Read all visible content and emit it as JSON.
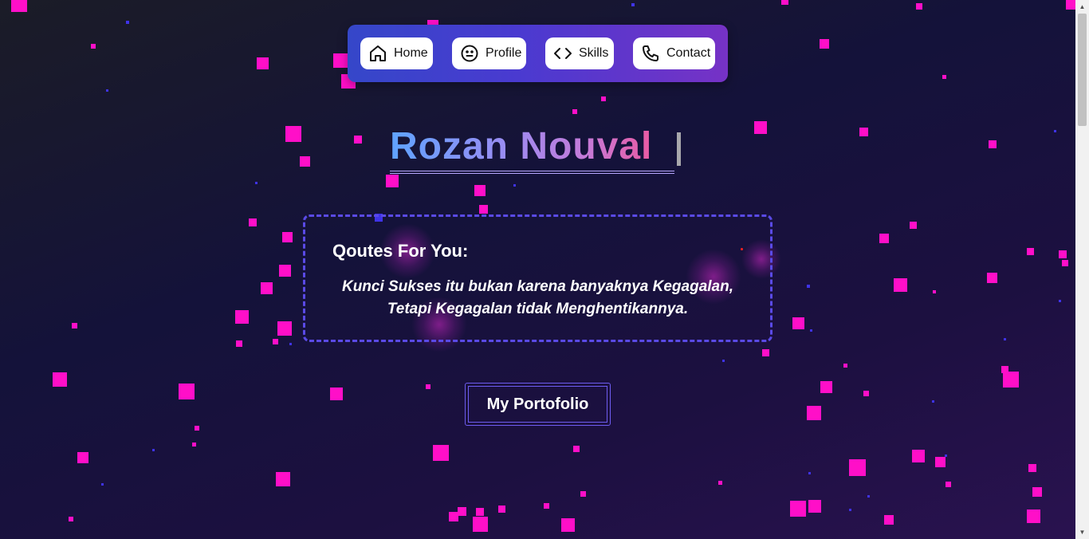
{
  "nav": {
    "items": [
      {
        "label": "Home",
        "icon": "home-icon"
      },
      {
        "label": "Profile",
        "icon": "smile-icon"
      },
      {
        "label": "Skills",
        "icon": "code-icon"
      },
      {
        "label": "Contact",
        "icon": "phone-icon"
      }
    ]
  },
  "hero": {
    "title": "Rozan Nouval"
  },
  "quote": {
    "heading": "Qoutes For You:",
    "line1": "Kunci Sukses itu bukan karena banyaknya Kegagalan,",
    "line2": "Tetapi Kegagalan tidak Menghentikannya."
  },
  "cta": {
    "label": "My Portofolio"
  },
  "colors": {
    "particle": "#ff0fc8",
    "accent": "#5a4ae6",
    "nav_gradient_start": "#3547c9",
    "nav_gradient_end": "#7632c6"
  }
}
